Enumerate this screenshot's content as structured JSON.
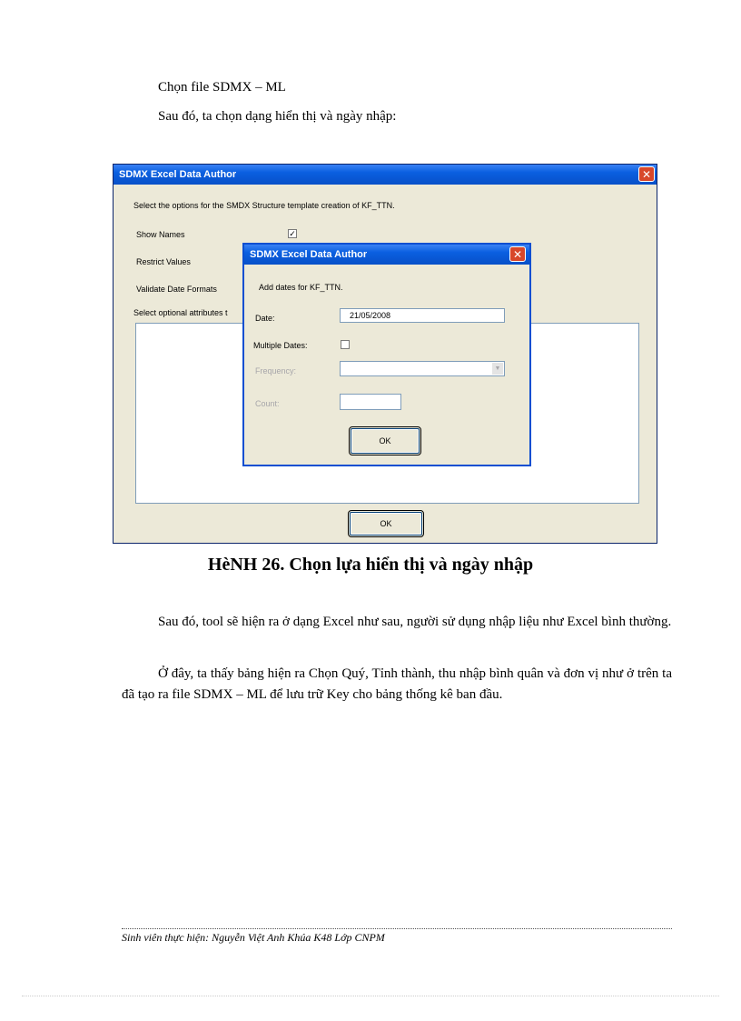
{
  "intro": {
    "line1": "Chọn file SDMX – ML",
    "line2": "Sau đó, ta chọn dạng hiển thị và ngày nhập:"
  },
  "screenshot": {
    "outer": {
      "title": "SDMX Excel Data Author",
      "description": "Select the options for the SMDX Structure template creation of KF_TTN.",
      "show_names_label": "Show Names",
      "show_names_checked": "✓",
      "restrict_values_label": "Restrict Values",
      "validate_date_formats_label": "Validate Date Formats",
      "optional_attributes_label": "Select optional attributes t",
      "ok_button": "OK"
    },
    "inner": {
      "title": "SDMX Excel Data Author",
      "description": "Add dates for KF_TTN.",
      "date_label": "Date:",
      "date_value": "21/05/2008",
      "multiple_dates_label": "Multiple Dates:",
      "frequency_label": "Frequency:",
      "count_label": "Count:",
      "ok_button": "OK"
    },
    "close_glyph": "✕",
    "combo_arrow_glyph": "▼"
  },
  "figure_caption": "HèNH 26. Chọn lựa hiển thị và ngày nhập",
  "body": {
    "para1": "Sau đó, tool sẽ hiện ra ở dạng Excel như sau, người sử dụng nhập liệu như Excel bình thường.",
    "para2": "Ở đây, ta thấy bảng hiện ra Chọn Quý, Tỉnh thành, thu nhập bình quân và đơn vị như ở trên ta đã tạo ra file SDMX – ML để lưu trữ Key cho bảng thống kê ban đầu."
  },
  "footer": "Sinh viên thực hiện: Nguyễn Việt Anh Khúa K48 Lớp CNPM"
}
